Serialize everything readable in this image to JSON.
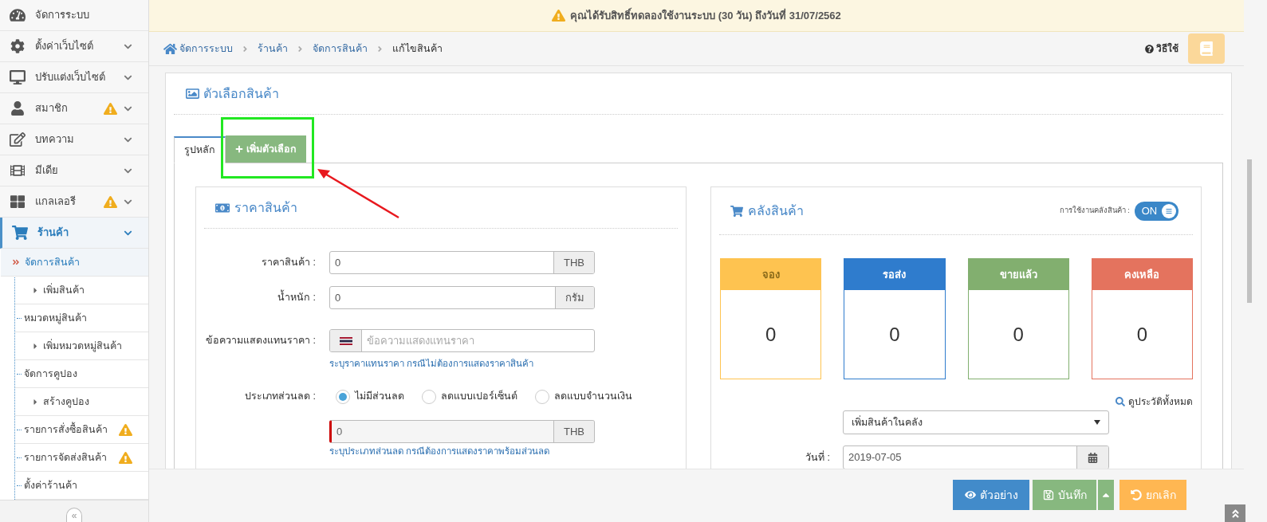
{
  "sidebar": {
    "items": [
      {
        "label": "จัดการระบบ",
        "expandable": false,
        "selected": false
      },
      {
        "label": "ตั้งค่าเว็บไซต์",
        "expandable": true,
        "selected": false
      },
      {
        "label": "ปรับแต่งเว็บไซต์",
        "expandable": true,
        "selected": false
      },
      {
        "label": "สมาชิก",
        "expandable": true,
        "warning": true,
        "selected": false
      },
      {
        "label": "บทความ",
        "expandable": true,
        "selected": false
      },
      {
        "label": "มีเดีย",
        "expandable": true,
        "selected": false
      },
      {
        "label": "แกลเลอรี",
        "expandable": true,
        "warning": true,
        "selected": false
      },
      {
        "label": "ร้านค้า",
        "expandable": true,
        "selected": true,
        "children": [
          {
            "label": "จัดการสินค้า",
            "selected": true,
            "children": [
              {
                "label": "เพิ่มสินค้า",
                "selected": false
              }
            ]
          },
          {
            "label": "หมวดหมู่สินค้า",
            "selected": false,
            "children": [
              {
                "label": "เพิ่มหมวดหมู่สินค้า",
                "selected": false
              }
            ]
          },
          {
            "label": "จัดการคูปอง",
            "selected": false,
            "children": [
              {
                "label": "สร้างคูปอง",
                "selected": false
              }
            ]
          },
          {
            "label": "รายการสั่งซื้อสินค้า",
            "selected": false,
            "warning": true
          },
          {
            "label": "รายการจัดส่งสินค้า",
            "selected": false,
            "warning": true
          },
          {
            "label": "ตั้งค่าร้านค้า",
            "selected": false
          }
        ]
      }
    ],
    "collapse_label": "«"
  },
  "banner": {
    "text": "คุณได้รับสิทธิ์ทดลองใช้งานระบบ (30 วัน) ถึงวันที่ 31/07/2562"
  },
  "breadcrumb": [
    "จัดการระบบ",
    "ร้านค้า",
    "จัดการสินค้า",
    "แก้ไขสินค้า"
  ],
  "help_link": "วิธีใช้",
  "panel": {
    "title": "ตัวเลือกสินค้า",
    "tabs": [
      {
        "label": "รูปหลัก",
        "selected": true,
        "kind": "tab"
      },
      {
        "label": "เพิ่มตัวเลือก",
        "selected": false,
        "kind": "add"
      }
    ],
    "price_card": {
      "title": "ราคาสินค้า",
      "price": {
        "label": "ราคาสินค้า :",
        "value": "0",
        "unit": "THB"
      },
      "weight": {
        "label": "น้ำหนัก :",
        "value": "0",
        "unit": "กรัม"
      },
      "alt_text": {
        "label": "ข้อความแสดงแทนราคา :",
        "placeholder": "ข้อความแสดงแทนราคา",
        "help": "ระบุราคาแทนราคา กรณีไม่ต้องการแสดงราคาสินค้า"
      },
      "discount": {
        "label": "ประเภทส่วนลด :",
        "options": [
          {
            "label": "ไม่มีส่วนลด",
            "selected": true
          },
          {
            "label": "ลดแบบเปอร์เซ็นต์",
            "selected": false
          },
          {
            "label": "ลดแบบจำนวนเงิน",
            "selected": false
          }
        ],
        "value": "0",
        "unit": "THB",
        "disabled": true,
        "help": "ระบุประเภทส่วนลด กรณีต้องการแสดงราคาพร้อมส่วนลด"
      }
    },
    "stock_card": {
      "title": "คลังสินค้า",
      "toggle_label": "การใช้งานคลังสินค้า :",
      "toggle": {
        "on": true,
        "text": "ON"
      },
      "stats": [
        {
          "label": "จอง",
          "value": "0",
          "color": "#fec350"
        },
        {
          "label": "รอส่ง",
          "value": "0",
          "color": "#2f7ccd"
        },
        {
          "label": "ขายแล้ว",
          "value": "0",
          "color": "#82af6f"
        },
        {
          "label": "คงเหลือ",
          "value": "0",
          "color": "#e4735e"
        }
      ],
      "history_link": "ดูประวัติทั้งหมด",
      "action_select": "เพิ่มสินค้าในคลัง",
      "date_label": "วันที่ :",
      "date_value": "2019-07-05"
    }
  },
  "footer": {
    "buttons": [
      {
        "label": "ตัวอย่าง",
        "kind": "preview"
      },
      {
        "label": "บันทึก",
        "kind": "save"
      },
      {
        "kind": "save-menu"
      },
      {
        "label": "ยกเลิก",
        "kind": "cancel"
      }
    ]
  }
}
